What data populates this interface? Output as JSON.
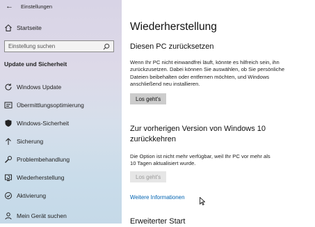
{
  "window": {
    "title": "Einstellungen"
  },
  "sidebar": {
    "home_label": "Startseite",
    "search": {
      "placeholder": "Einstellung suchen",
      "value": ""
    },
    "section_title": "Update und Sicherheit",
    "items": [
      {
        "label": "Windows Update",
        "icon": "refresh-icon"
      },
      {
        "label": "Übermittlungsoptimierung",
        "icon": "delivery-icon"
      },
      {
        "label": "Windows-Sicherheit",
        "icon": "shield-icon"
      },
      {
        "label": "Sicherung",
        "icon": "backup-arrow-icon"
      },
      {
        "label": "Problembehandlung",
        "icon": "wrench-icon"
      },
      {
        "label": "Wiederherstellung",
        "icon": "recovery-icon"
      },
      {
        "label": "Aktivierung",
        "icon": "check-circle-icon"
      },
      {
        "label": "Mein Gerät suchen",
        "icon": "person-pin-icon"
      }
    ]
  },
  "main": {
    "title": "Wiederherstellung",
    "reset": {
      "heading": "Diesen PC zurücksetzen",
      "lines": [
        "Wenn Ihr PC nicht einwandfrei läuft, könnte es hilfreich sein, ihn",
        "zurückzusetzen. Dabei können Sie auswählen, ob Sie persönliche",
        "Dateien beibehalten oder entfernen möchten, und Windows",
        "anschließend neu installieren."
      ],
      "button": "Los geht's"
    },
    "previous": {
      "heading_lines": [
        "Zur vorherigen Version von Windows 10",
        "zurückkehren"
      ],
      "lines": [
        "Die Option ist nicht mehr verfügbar, weil Ihr PC vor mehr als",
        "10 Tagen aktualisiert wurde."
      ],
      "button": "Los geht's"
    },
    "link": "Weitere Informationen",
    "advanced_heading": "Erweiterter Start"
  },
  "colors": {
    "accent": "#0063b1",
    "button": "#cccccc",
    "button_disabled": "#e6e6e6"
  }
}
